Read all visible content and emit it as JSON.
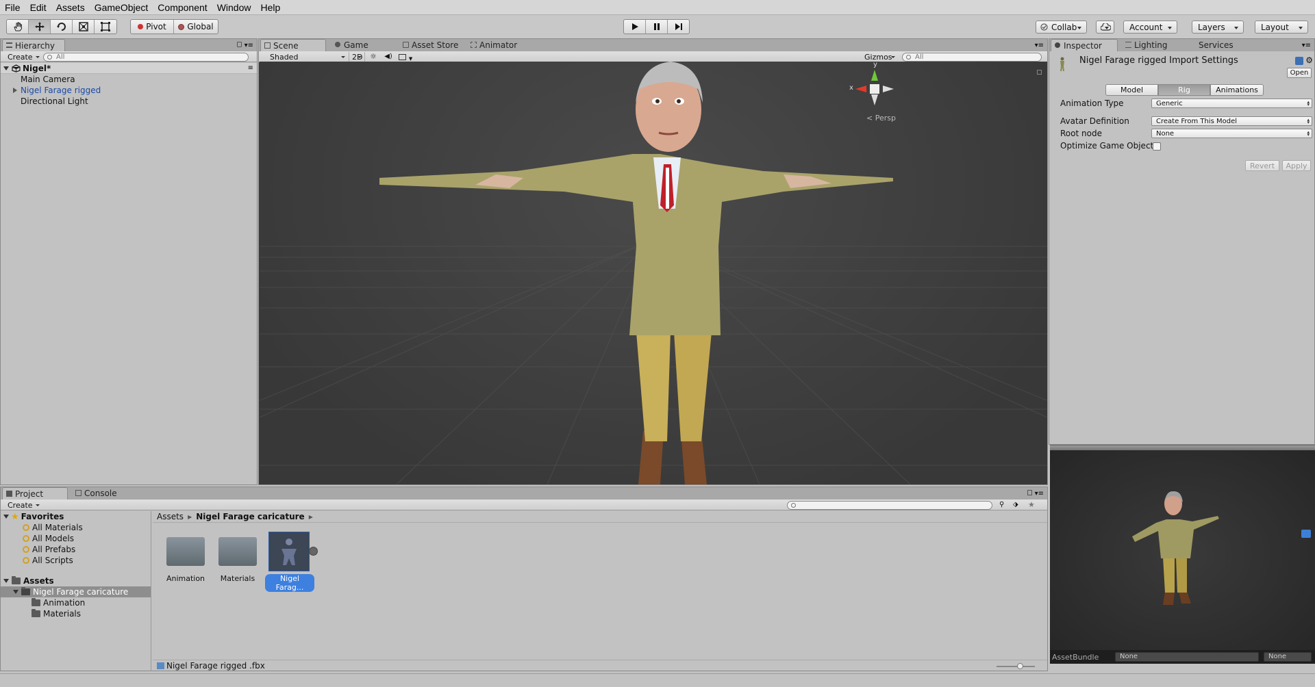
{
  "menu": [
    "File",
    "Edit",
    "Assets",
    "GameObject",
    "Component",
    "Window",
    "Help"
  ],
  "toolbar": {
    "pivot": "Pivot",
    "global": "Global",
    "collab": "Collab",
    "account": "Account",
    "layers": "Layers",
    "layout": "Layout"
  },
  "hierarchy": {
    "tab": "Hierarchy",
    "create": "Create",
    "search_placeholder": "All",
    "scene_name": "Nigel*",
    "items": [
      "Main Camera",
      "Nigel Farage rigged",
      "Directional Light"
    ]
  },
  "scene": {
    "tabs": [
      "Scene",
      "Game",
      "Asset Store",
      "Animator"
    ],
    "shading": "Shaded",
    "mode_2d": "2D",
    "gizmos": "Gizmos",
    "search_placeholder": "All",
    "persp": "Persp",
    "axis_x": "x",
    "axis_y": "y"
  },
  "inspector": {
    "tabs": [
      "Inspector",
      "Lighting",
      "Services"
    ],
    "title": "Nigel Farage rigged  Import Settings",
    "open_btn": "Open",
    "segments": [
      "Model",
      "Rig",
      "Animations"
    ],
    "active_segment": "Rig",
    "props": [
      {
        "label": "Animation Type",
        "value": "Generic"
      },
      {
        "label": "Avatar Definition",
        "value": "Create From This Model"
      },
      {
        "label": "Root node",
        "value": "None"
      }
    ],
    "optimize_label": "Optimize Game Objects",
    "revert": "Revert",
    "apply": "Apply",
    "assetbundle_label": "AssetBundle",
    "assetbundle_value": "None",
    "assetbundle_variant": "None"
  },
  "project": {
    "tabs": [
      "Project",
      "Console"
    ],
    "create": "Create",
    "favorites_label": "Favorites",
    "favorites": [
      "All Materials",
      "All Models",
      "All Prefabs",
      "All Scripts"
    ],
    "assets_label": "Assets",
    "tree": [
      "Nigel Farage caricature",
      "Animation",
      "Materials"
    ],
    "breadcrumb": [
      "Assets",
      "Nigel Farage caricature"
    ],
    "items": [
      "Animation",
      "Materials",
      "Nigel Farag..."
    ],
    "status_file": "Nigel Farage rigged .fbx"
  },
  "colors": {
    "selection": "#3d80df",
    "scene_bg": "#404040",
    "panel": "#c2c2c2"
  }
}
